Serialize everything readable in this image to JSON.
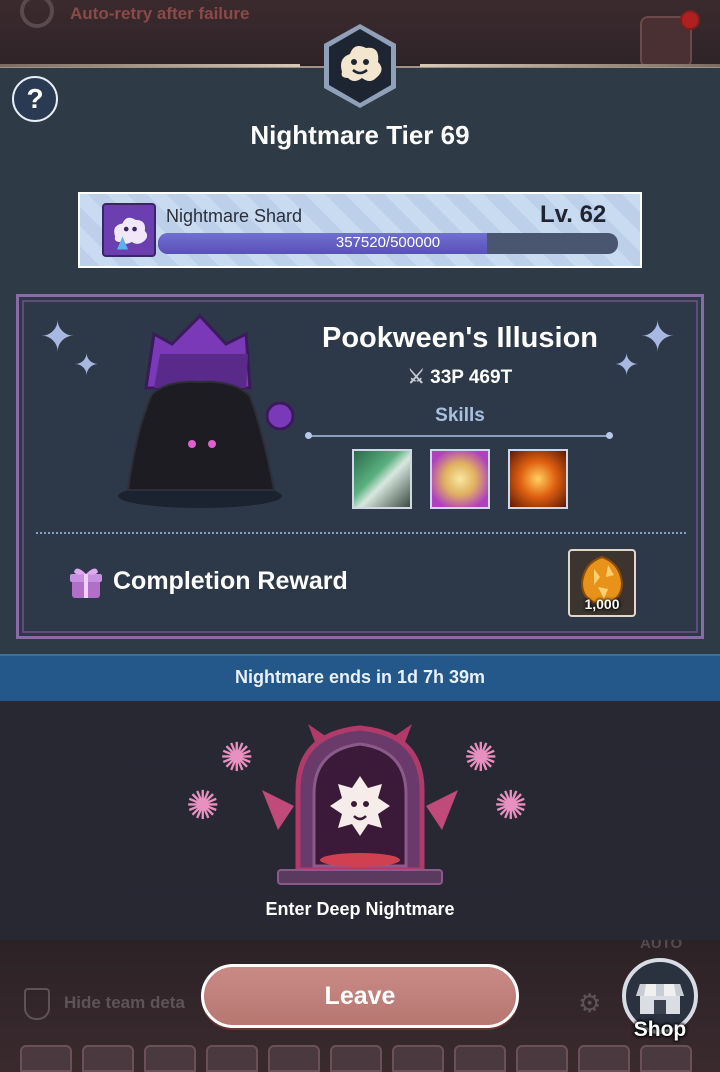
{
  "background": {
    "auto_retry_label": "Auto-retry after failure",
    "hide_team_label": "Hide team deta",
    "auto_label": "AUTO"
  },
  "popup": {
    "title": "Nightmare Tier 69",
    "help_label": "?",
    "shard": {
      "name": "Nightmare Shard",
      "level": "Lv. 62",
      "progress_text": "357520/500000",
      "progress_fraction": 0.715
    },
    "boss": {
      "name": "Pookween's Illusion",
      "power": "33P 469T",
      "skills_label": "Skills",
      "skills": [
        "blade-strike-skill-icon",
        "radiant-burst-skill-icon",
        "flame-aura-skill-icon"
      ]
    },
    "reward": {
      "label": "Completion Reward",
      "quantity": "1,000"
    },
    "timer_text": "Nightmare ends in 1d 7h 39m",
    "deep_nightmare_label": "Enter Deep Nightmare",
    "leave_label": "Leave",
    "shop_label": "Shop"
  },
  "colors": {
    "panel": "#2e3a46",
    "accent_purple": "#8a6aa8",
    "timer_band": "#24588a",
    "leave_button": "#c98a86"
  }
}
